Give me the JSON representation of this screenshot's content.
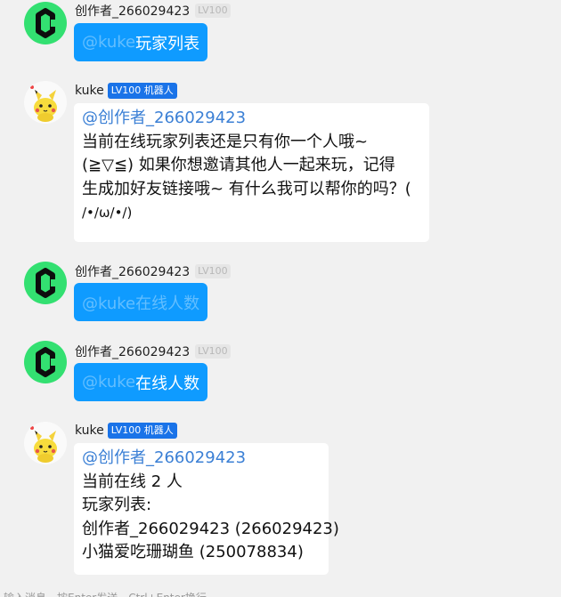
{
  "messages": [
    {
      "sender": "创作者_266029423",
      "level": "LV100",
      "mention": "@kuke",
      "text": " 玩家列表"
    },
    {
      "sender": "kuke",
      "level": "LV100 机器人",
      "mention": "@创作者_266029423",
      "lines": [
        "当前在线玩家列表还是只有你一个人哦~",
        "(≧▽≦) 如果你想邀请其他人一起来玩，记得",
        "生成加好友链接哦~ 有什么我可以帮你的吗？(",
        "/•/ω/•/)"
      ]
    },
    {
      "sender": "创作者_266029423",
      "level": "LV100",
      "text": "@kuke在线人数"
    },
    {
      "sender": "创作者_266029423",
      "level": "LV100",
      "mention": "@kuke",
      "text": " 在线人数"
    },
    {
      "sender": "kuke",
      "level": "LV100 机器人",
      "mention": "@创作者_266029423",
      "lines": [
        "当前在线 2 人",
        "玩家列表:",
        "创作者_266029423 (266029423)",
        "小猫爱吃珊瑚鱼 (250078834)"
      ]
    }
  ],
  "input_hint": "输入消息，按Enter发送，Ctrl+Enter换行"
}
